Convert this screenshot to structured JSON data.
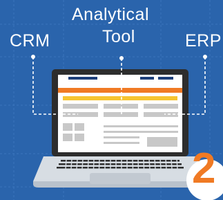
{
  "labels": {
    "crm": "CRM",
    "analytical": "Analytical",
    "tool": "Tool",
    "erp": "ERP"
  },
  "step_number": "2",
  "colors": {
    "background": "#2a64ac",
    "grid": "#3a74bc",
    "laptop_body": "#2d2d2d",
    "laptop_base": "#d7dde3",
    "screen": "#ffffff",
    "accent_orange": "#f07a24",
    "accent_yellow": "#f6c431",
    "ui_gray": "#c8c8c8",
    "ui_navy": "#1d3f7a",
    "connector": "#ffffff"
  },
  "icons": {
    "laptop": "laptop-icon",
    "keyboard": "keyboard-icon",
    "trackpad": "trackpad-icon"
  }
}
